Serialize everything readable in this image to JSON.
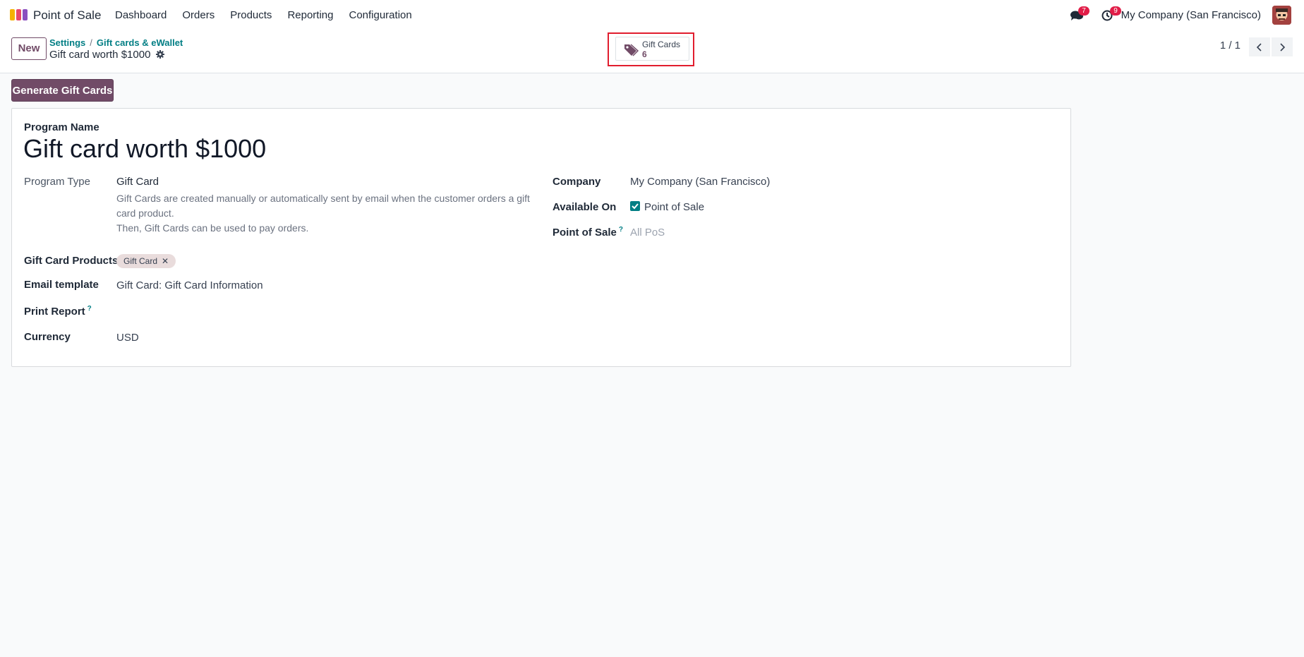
{
  "navbar": {
    "app_name": "Point of Sale",
    "menu": [
      "Dashboard",
      "Orders",
      "Products",
      "Reporting",
      "Configuration"
    ],
    "messages_count": "7",
    "activities_count": "9",
    "company": "My Company (San Francisco)"
  },
  "control_panel": {
    "new_label": "New",
    "breadcrumb": [
      "Settings",
      "Gift cards & eWallet"
    ],
    "breadcrumb_sep": "/",
    "record_title": "Gift card worth $1000",
    "smart_button": {
      "label": "Gift Cards",
      "count": "6"
    },
    "pager": "1 / 1"
  },
  "actions": {
    "generate_label": "Generate Gift Cards"
  },
  "form": {
    "program_name_label": "Program Name",
    "program_name": "Gift card worth $1000",
    "program_type_label": "Program Type",
    "program_type": "Gift Card",
    "program_type_desc_1": "Gift Cards are created manually or automatically sent by email when the customer orders a gift card product.",
    "program_type_desc_2": "Then, Gift Cards can be used to pay orders.",
    "products_label": "Gift Card Products",
    "products_tag": "Gift Card",
    "email_template_label": "Email template",
    "email_template": "Gift Card: Gift Card Information",
    "print_report_label": "Print Report",
    "help_mark": "?",
    "currency_label": "Currency",
    "currency": "USD",
    "company_label": "Company",
    "company": "My Company (San Francisco)",
    "available_on_label": "Available On",
    "available_on": "Point of Sale",
    "available_on_checked": true,
    "pos_label": "Point of Sale",
    "pos_placeholder": "All PoS"
  },
  "colors": {
    "brand": "#714b67",
    "accent": "#017e84",
    "badge": "#e11d48",
    "highlight": "#e11d2e"
  }
}
